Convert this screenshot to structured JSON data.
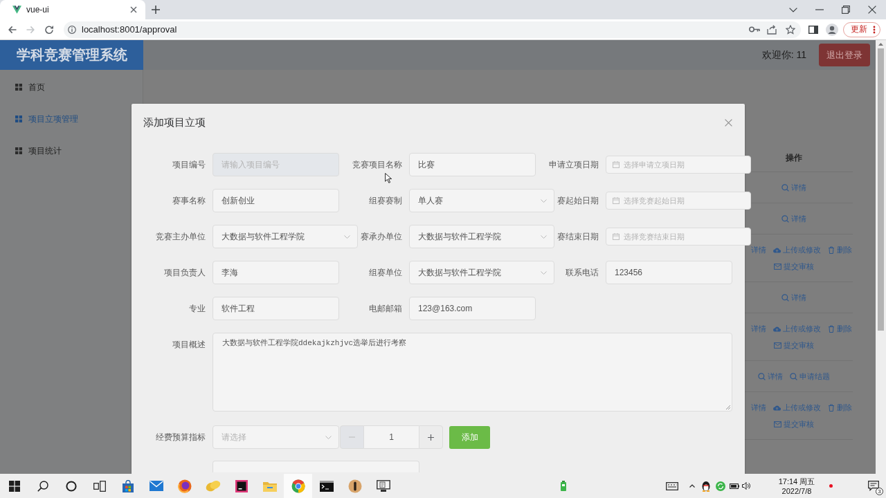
{
  "browser": {
    "tabs": [
      {
        "title": "vue-ui",
        "selected": true
      }
    ],
    "nav_buttons": [
      {
        "kind": "back",
        "disabled": false
      },
      {
        "kind": "forward",
        "disabled": true
      },
      {
        "kind": "reload",
        "disabled": false
      }
    ],
    "url": "localhost:8001/approval",
    "update_button": "更新"
  },
  "header": {
    "app_title": "学科竞赛管理系统",
    "welcome": "欢迎你: 11",
    "logout_button": "退出登录"
  },
  "sidebar": {
    "items": [
      {
        "label": "首页",
        "selected": false
      },
      {
        "label": "项目立项管理",
        "selected": true
      },
      {
        "label": "项目统计",
        "selected": false
      }
    ]
  },
  "table": {
    "columns": [
      "操作"
    ],
    "rows": [
      {
        "actions": [
          {
            "label": "详情",
            "kind": "detail",
            "icon_covered": false
          }
        ]
      },
      {
        "actions": [
          {
            "label": "详情",
            "kind": "detail",
            "icon_covered": false
          }
        ]
      },
      {
        "actions": [
          {
            "label": "详情",
            "icon_covered": true
          },
          {
            "label": "上传或修改",
            "kind": "upload",
            "icon_covered": false
          },
          {
            "label": "删除",
            "kind": "delete",
            "icon_covered": false
          },
          {
            "label": "提交审核",
            "kind": "submit",
            "icon_covered": false
          }
        ]
      },
      {
        "actions": [
          {
            "label": "详情",
            "kind": "detail",
            "icon_covered": false
          }
        ]
      },
      {
        "actions": [
          {
            "label": "详情",
            "icon_covered": true
          },
          {
            "label": "上传或修改",
            "kind": "upload",
            "icon_covered": false
          },
          {
            "label": "删除",
            "kind": "delete",
            "icon_covered": false
          },
          {
            "label": "提交审核",
            "kind": "submit",
            "icon_covered": false
          }
        ]
      },
      {
        "actions": [
          {
            "label": "详情",
            "kind": "detail",
            "icon_covered": false
          },
          {
            "label": "申请结题",
            "kind": "finish",
            "icon_covered": false
          }
        ]
      },
      {
        "actions": [
          {
            "label": "详情",
            "icon_covered": true
          },
          {
            "label": "上传或修改",
            "kind": "upload",
            "icon_covered": false
          },
          {
            "label": "删除",
            "kind": "delete",
            "icon_covered": false
          },
          {
            "label": "提交审核",
            "kind": "submit",
            "icon_covered": false
          }
        ]
      }
    ]
  },
  "dialog": {
    "title": "添加项目立项",
    "rows": [
      [
        {
          "label": "项目编号",
          "kind": "input",
          "placeholder": "请输入项目编号",
          "disabled": true
        },
        {
          "label": "竞赛项目名称",
          "kind": "input",
          "value": "比赛",
          "disabled": false
        },
        {
          "label": "申请立项日期",
          "kind": "date",
          "placeholder": "选择申请立项日期",
          "disabled": false
        }
      ],
      [
        {
          "label": "赛事名称",
          "kind": "input",
          "value": "创新创业",
          "disabled": false
        },
        {
          "label": "组赛赛制",
          "kind": "select",
          "value": "单人赛",
          "disabled": false
        },
        {
          "label": "赛起始日期",
          "kind": "date",
          "placeholder": "选择竞赛起始日期",
          "disabled": false
        }
      ],
      [
        {
          "label": "竞赛主办单位",
          "kind": "select",
          "value": "大数据与软件工程学院",
          "disabled": false
        },
        {
          "label": "赛承办单位",
          "kind": "select",
          "value": "大数据与软件工程学院",
          "disabled": false
        },
        {
          "label": "赛结束日期",
          "kind": "date",
          "placeholder": "选择竞赛结束日期",
          "disabled": false
        }
      ],
      [
        {
          "label": "项目负责人",
          "kind": "input",
          "value": "李海",
          "disabled": false
        },
        {
          "label": "组赛单位",
          "kind": "select",
          "value": "大数据与软件工程学院",
          "disabled": false
        },
        {
          "label": "联系电话",
          "kind": "input",
          "value": "123456",
          "disabled": false
        }
      ],
      [
        {
          "label": "专业",
          "kind": "input",
          "value": "软件工程",
          "disabled": false
        },
        {
          "label": "电邮邮箱",
          "kind": "input",
          "value": "123@163.com",
          "disabled": false
        }
      ]
    ],
    "description": {
      "label": "项目概述",
      "value": "大数据与软件工程学院ddekajkzhjvc选举后进行考察"
    },
    "budget": {
      "label": "经费预算指标",
      "placeholder": "请选择",
      "quantity": "1",
      "decrease_disabled": true,
      "add_button": "添加"
    },
    "next_field": {
      "kind": "input"
    }
  },
  "taskbar": {
    "apps": [
      {
        "kind": "start",
        "selected": false
      },
      {
        "kind": "search",
        "selected": false
      },
      {
        "kind": "assistant",
        "selected": false
      },
      {
        "kind": "task_view",
        "selected": false
      },
      {
        "kind": "store",
        "selected": false
      },
      {
        "kind": "mail",
        "selected": false
      },
      {
        "kind": "firefox",
        "selected": false
      },
      {
        "kind": "notes",
        "selected": false
      },
      {
        "kind": "ide",
        "selected": false
      },
      {
        "kind": "files",
        "selected": false
      },
      {
        "kind": "chrome",
        "selected": true
      },
      {
        "kind": "terminal",
        "selected": false
      },
      {
        "kind": "media",
        "selected": false
      },
      {
        "kind": "installer",
        "selected": false
      }
    ],
    "time": "17:14 周五",
    "date": "2022/7/8",
    "notification_count": "3"
  }
}
